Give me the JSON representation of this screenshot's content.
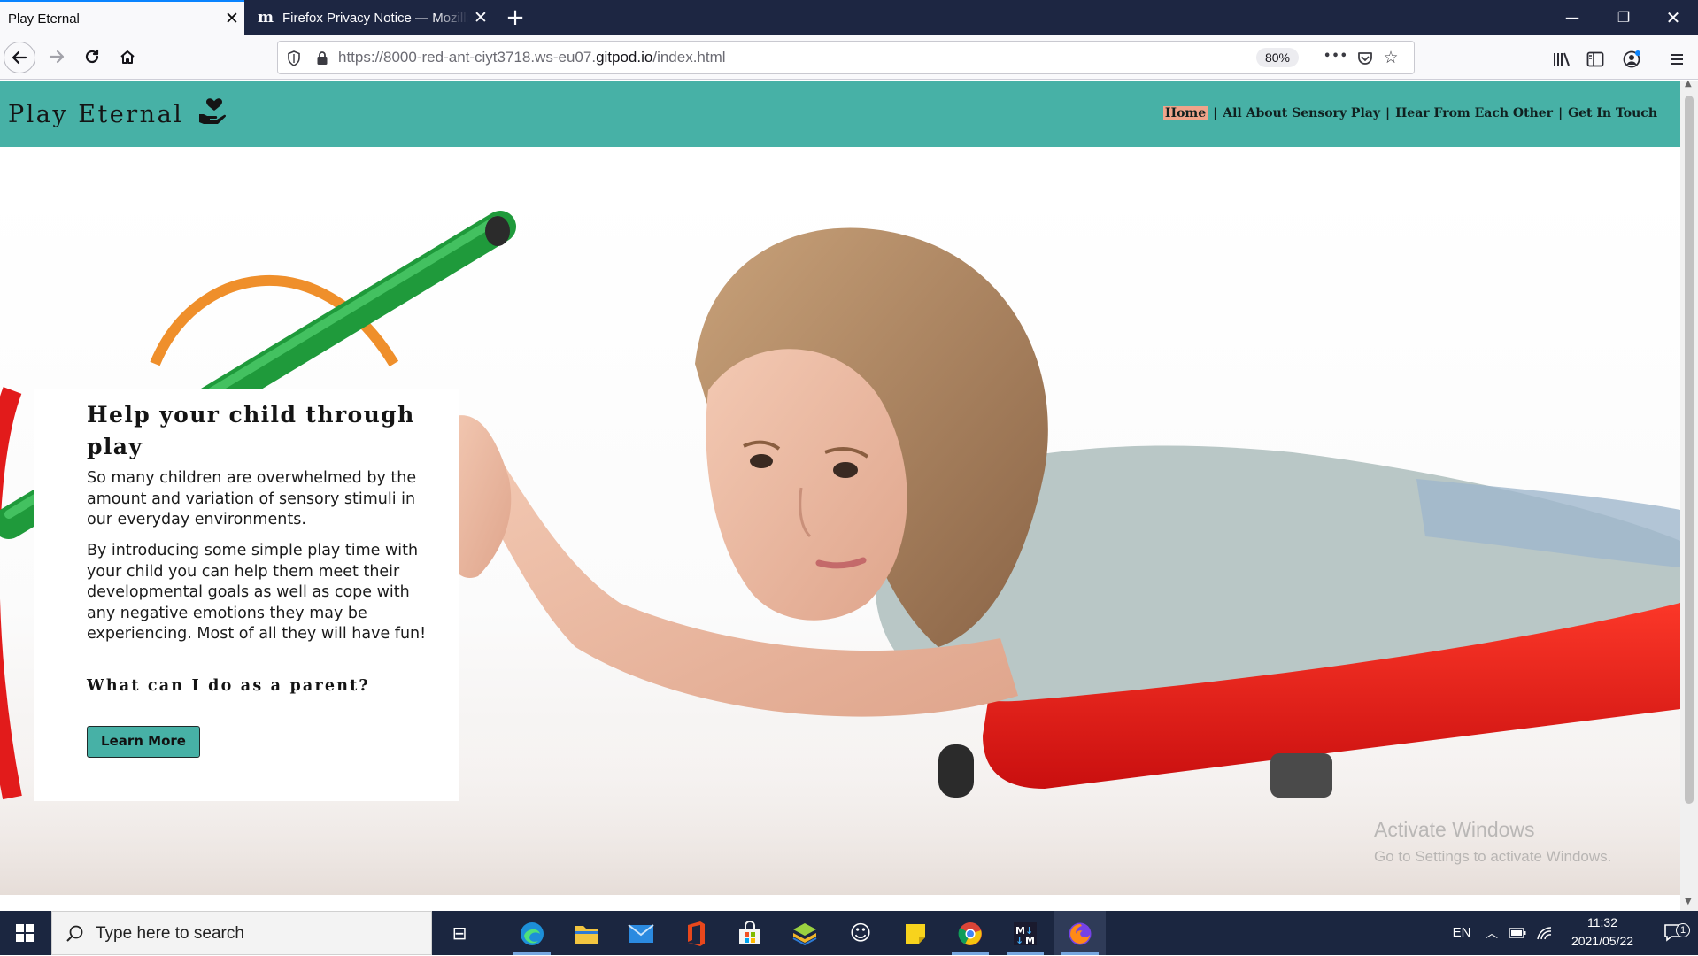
{
  "browser": {
    "tabs": [
      {
        "title": "Play Eternal",
        "active": true
      },
      {
        "title": "Firefox Privacy Notice — Mozilla",
        "active": false
      }
    ],
    "url_prefix": "https://8000-red-ant-ciyt3718.ws-eu07.",
    "url_domain": "gitpod.io",
    "url_path": "/index.html",
    "zoom": "80%",
    "accent_color": "#0a84ff"
  },
  "site": {
    "logo_text": "Play Eternal",
    "header_color": "#47b1a6",
    "nav": [
      {
        "label": "Home",
        "current": true
      },
      {
        "label": "All About Sensory Play"
      },
      {
        "label": "Hear From Each Other"
      },
      {
        "label": "Get In Touch"
      }
    ],
    "nav_separator": "|",
    "hero": {
      "heading": "Help your child through play",
      "paragraph1": "So many children are overwhelmed by the amount and variation of sensory stimuli in our everyday environments.",
      "paragraph2": "By introducing some simple play time with your child you can help them meet their developmental goals as well as cope with any negative emotions they may be experiencing. Most of all they will have fun!",
      "subheading": "What can I do as a parent?",
      "button_label": "Learn More"
    }
  },
  "watermark": {
    "line1": "Activate Windows",
    "line2": "Go to Settings to activate Windows."
  },
  "taskbar": {
    "search_placeholder": "Type here to search",
    "language": "EN",
    "time": "11:32",
    "date": "2021/05/22",
    "notification_count": "1"
  }
}
